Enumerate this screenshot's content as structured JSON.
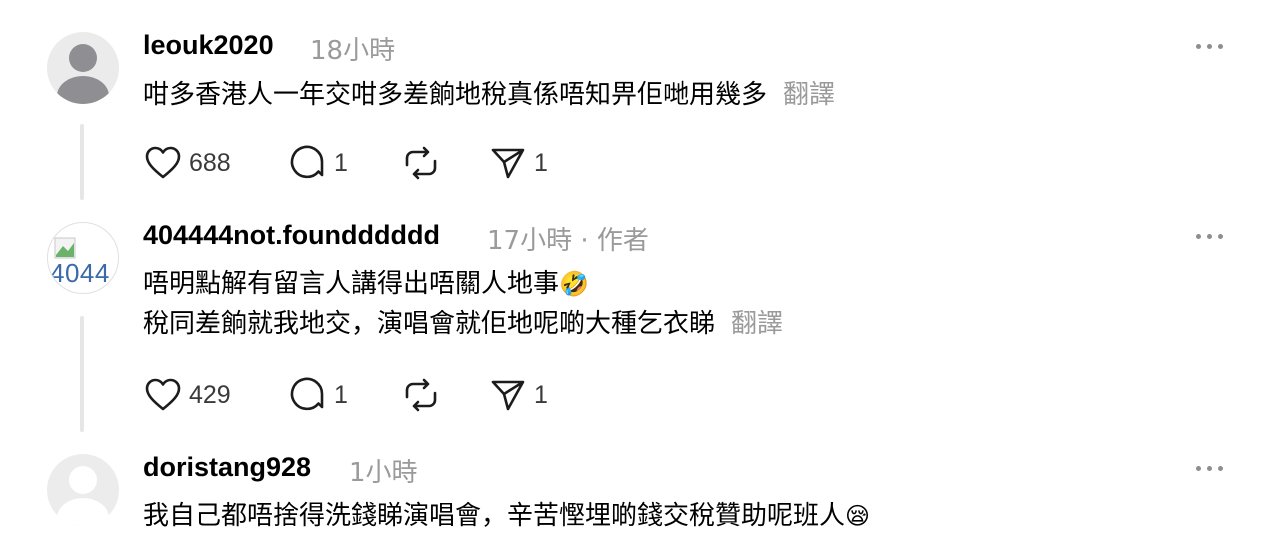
{
  "posts": [
    {
      "username": "leouk2020",
      "time": "18小時",
      "lines": [
        "咁多香港人一年交咁多差餉地稅真係唔知畀佢哋用幾多"
      ],
      "translate": "翻譯",
      "likes": "688",
      "replies": "1",
      "shares": "1"
    },
    {
      "username": "404444not.foundddddd",
      "time": "17小時",
      "author_badge": "· 作者",
      "avatar_text": "4044",
      "lines": [
        "唔明點解有留言人講得出唔關人地事",
        "稅同差餉就我地交，演唱會就佢地呢啲大種乞衣睇"
      ],
      "line1_emoji": "🤣",
      "translate": "翻譯",
      "likes": "429",
      "replies": "1",
      "shares": "1"
    },
    {
      "username": "doristang928",
      "time": "1小時",
      "lines": [
        "我自己都唔捨得洗錢睇演唱會，辛苦慳埋啲錢交稅贊助呢班人"
      ],
      "line1_emoji": "😪"
    }
  ]
}
